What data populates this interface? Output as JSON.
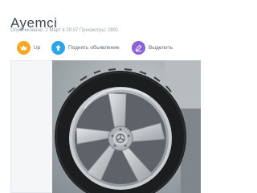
{
  "listing": {
    "title": "Ayemci",
    "meta": "Опубликовано: 2 Март в 20:07 Просмотры: 2891"
  },
  "actions": {
    "up_label": "Up",
    "raise_label": "Поднять объявление",
    "highlight_label": "Выделить"
  },
  "colors": {
    "title_text": "#3d4a56",
    "up_button": "#f7a823",
    "raise_button": "#2aa5e6",
    "highlight_button": "#8a63d6"
  },
  "icons": {
    "up": "crown-icon",
    "raise": "arrow-up-icon",
    "highlight": "pencil-icon"
  }
}
